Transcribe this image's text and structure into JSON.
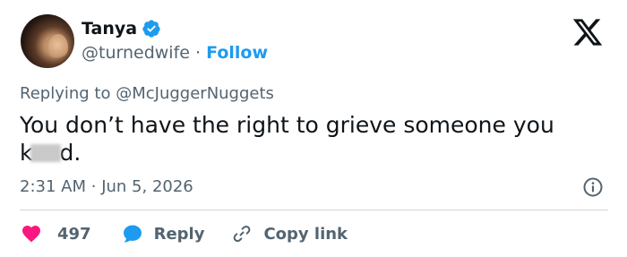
{
  "author": {
    "name": "Tanya",
    "handle": "@turnedwife",
    "separator": "·",
    "follow_label": "Follow"
  },
  "reply_context": {
    "prefix": "Replying to",
    "mention": "@McJuggerNuggets"
  },
  "tweet": {
    "line1": "You don’t have the right to grieve someone you",
    "line2_start": "k",
    "line2_end": "d."
  },
  "meta": {
    "time": "2:31 AM",
    "separator": "·",
    "date": "Jun 5, 2026"
  },
  "actions": {
    "like_count": "497",
    "reply_label": "Reply",
    "copy_label": "Copy link"
  },
  "colors": {
    "like": "#f91880",
    "reply": "#1d9bf0",
    "accent": "#1d9bf0",
    "muted": "#536471",
    "text": "#0f1419"
  }
}
